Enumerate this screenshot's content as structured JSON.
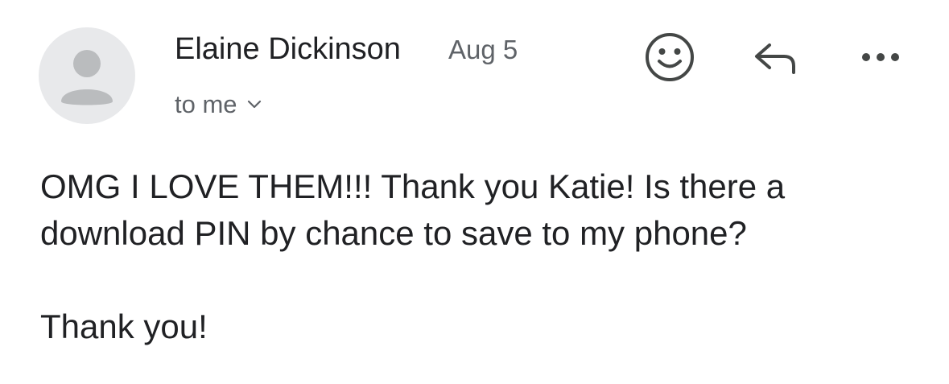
{
  "email": {
    "sender_name": "Elaine Dickinson",
    "date": "Aug 5",
    "recipient_label": "to me",
    "body": {
      "line1": "OMG I LOVE THEM!!! Thank you Katie! Is there a",
      "line2": "download PIN by chance to save to my phone?",
      "line3": "Thank you!"
    }
  },
  "icons": {
    "avatar": "person-placeholder-icon",
    "recipient_toggle": "chevron-down-icon",
    "emoji": "smiley-face-icon",
    "reply": "reply-arrow-icon",
    "more": "more-horizontal-icon"
  },
  "colors": {
    "text_primary": "#202124",
    "text_secondary": "#5f6368",
    "avatar_bg": "#e8e9eb",
    "avatar_fg": "#babcbe"
  }
}
